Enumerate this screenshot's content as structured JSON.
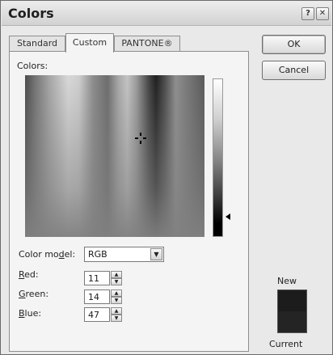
{
  "window": {
    "title": "Colors"
  },
  "titlebar": {
    "help_glyph": "?",
    "close_glyph": "✕"
  },
  "tabs": [
    {
      "label": "Standard",
      "active": false
    },
    {
      "label": "Custom",
      "active": true
    },
    {
      "label": "PANTONE®",
      "active": false
    }
  ],
  "custom": {
    "colors_label": "Colors:",
    "color_model": {
      "label_pre": "Color mo",
      "label_key": "d",
      "label_post": "el:",
      "value": "RGB"
    },
    "red": {
      "label_pre": "",
      "label_key": "R",
      "label_post": "ed:",
      "value": "11"
    },
    "green": {
      "label_pre": "",
      "label_key": "G",
      "label_post": "reen:",
      "value": "14"
    },
    "blue": {
      "label_pre": "",
      "label_key": "B",
      "label_post": "lue:",
      "value": "47"
    }
  },
  "buttons": {
    "ok": "OK",
    "cancel": "Cancel"
  },
  "preview": {
    "new_label": "New",
    "current_label": "Current",
    "new_color": "#1c1c1c",
    "current_color": "#242424"
  }
}
